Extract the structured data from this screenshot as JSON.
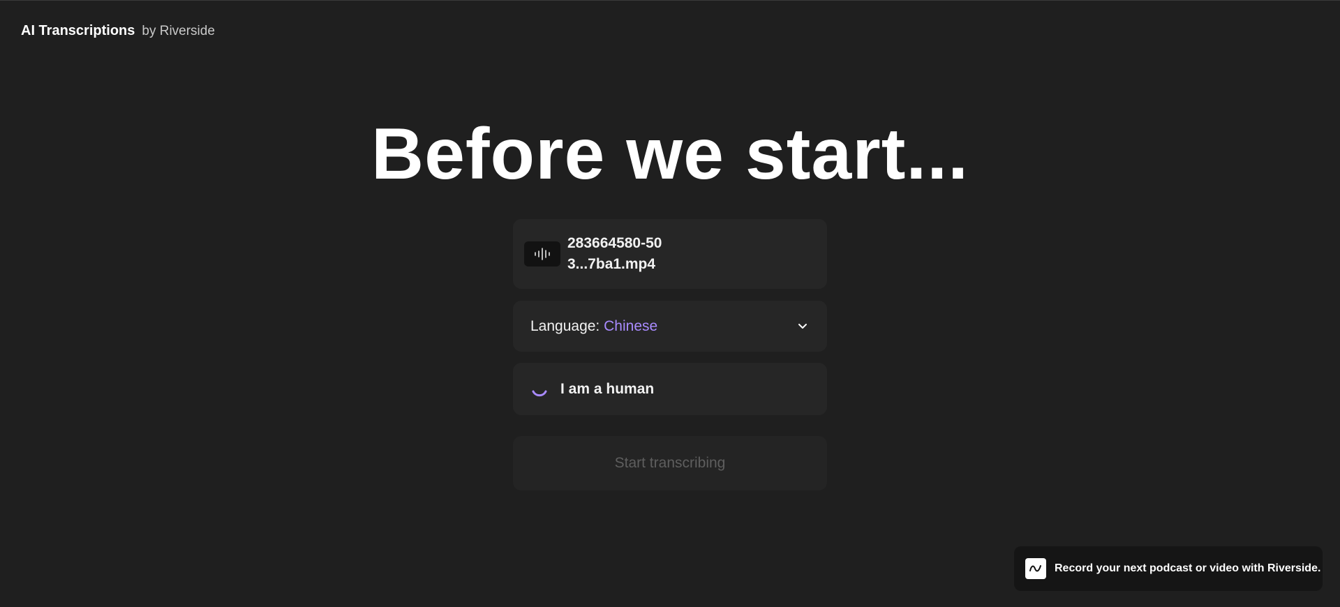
{
  "header": {
    "brand_name": "AI Transcriptions",
    "brand_by": "by Riverside"
  },
  "main": {
    "headline": "Before we start...",
    "file": {
      "icon": "audio-waveform-icon",
      "name": "283664580-503...7ba1.mp4"
    },
    "language": {
      "label": "Language:",
      "value": "Chinese",
      "icon": "chevron-down-icon"
    },
    "captcha": {
      "label": "I am a human",
      "icon": "loading-spinner-icon"
    },
    "start_button_label": "Start transcribing"
  },
  "promo": {
    "icon": "riverside-logo-icon",
    "text": "Record your next podcast or video with Riverside."
  },
  "colors": {
    "background": "#1f1f1f",
    "card": "#262626",
    "accent": "#a98bff",
    "disabled_text": "#5e5e5e"
  }
}
